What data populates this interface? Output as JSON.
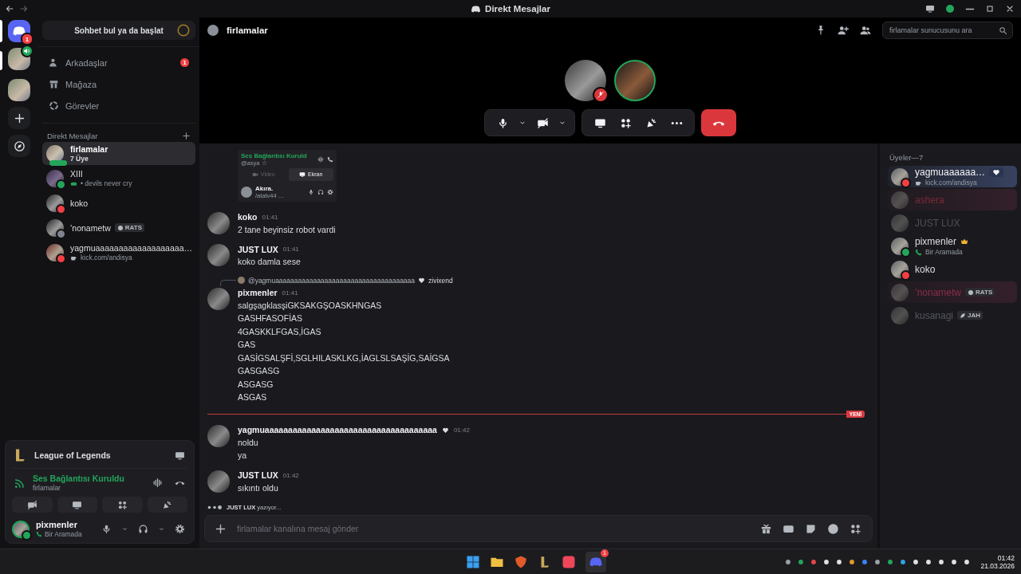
{
  "titlebar": {
    "title": "Direkt Mesajlar"
  },
  "servers": [
    {
      "kind": "home",
      "selected": true,
      "unread": false,
      "badge": "1",
      "speaking": false
    },
    {
      "kind": "server",
      "selected": false,
      "unread": true,
      "speaking": true
    },
    {
      "kind": "server",
      "selected": false,
      "unread": false,
      "speaking": false
    },
    {
      "kind": "add",
      "selected": false,
      "unread": false,
      "speaking": false
    },
    {
      "kind": "discover",
      "selected": false,
      "unread": false,
      "speaking": false
    }
  ],
  "dm_sidebar": {
    "search_button": "Sohbet bul ya da başlat",
    "nav": [
      {
        "kind": "friends",
        "label": "Arkadaşlar",
        "badge": "1"
      },
      {
        "kind": "shop",
        "label": "Mağaza"
      },
      {
        "kind": "quests",
        "label": "Görevler"
      }
    ],
    "section_title": "Direkt Mesajlar",
    "dms": [
      {
        "kind": "group",
        "name": "firlamalar",
        "subtitle": "7 Üye",
        "selected": true,
        "in_call": true
      },
      {
        "kind": "game",
        "name": "XIII",
        "subtitle": "• devils never cry",
        "selected": false,
        "in_call": false,
        "color": "#23a55a"
      },
      {
        "kind": "user",
        "name": "koko",
        "selected": false,
        "in_call": false,
        "color": "#f23f43"
      },
      {
        "kind": "user",
        "name": "ʼnonametw",
        "tag": "RATS",
        "selected": false,
        "in_call": false,
        "color": "#80848e"
      },
      {
        "kind": "custom",
        "name": "yagmuaaaaaaaaaaaaaaaaaaa…",
        "subtitle": "kick.com/andisya",
        "selected": false,
        "in_call": false,
        "color": "#f23f43"
      }
    ]
  },
  "user_panel": {
    "activity": {
      "title": "League of Legends"
    },
    "voice": {
      "status": "Ses Bağlantısı Kuruldu",
      "channel": "firlamalar"
    },
    "user": {
      "name": "pixmenler",
      "status": "Bir Aramada"
    }
  },
  "channel_header": {
    "name": "firlamalar",
    "search_placeholder": "firlamalar sunucusunu ara"
  },
  "call": {
    "participants": [
      {
        "muted": true,
        "speaking": false
      },
      {
        "muted": false,
        "speaking": true
      }
    ]
  },
  "chat": {
    "attachment": {
      "voice_status": "Ses Bağlantısı Kuruld",
      "user_line": "@asya ☆",
      "tabs": [
        {
          "label": "Video",
          "selected": false
        },
        {
          "label": "Ekran",
          "selected": true
        }
      ],
      "user_name": "Akıra.",
      "user_status": "/atatv44 …"
    },
    "messages": [
      {
        "kind": "message",
        "author": "koko",
        "time": "01:41",
        "lines": [
          "2 tane beyinsiz robot vardi"
        ]
      },
      {
        "kind": "message",
        "author": "JUST LUX",
        "time": "01:41",
        "lines": [
          "koko damla sese"
        ]
      },
      {
        "kind": "message",
        "author": "pixmenler",
        "time": "01:41",
        "reply": {
          "author": "@yagmuaaaaaaaaaaaaaaaaaaaaaaaaaaaaaaaaaaaaa",
          "text": "zivixend"
        },
        "lines": [
          "salgşagklasşiGKSAKGŞOASKHNGAS",
          "GASHFASOFİAS",
          "4GASKKLFGAS,İGAS",
          "GAS",
          "GASİGSALŞFİ,SGLHILASKLKG,İAGLSLSAŞİG,SAİGSA",
          "GASGASG",
          "ASGASG",
          "ASGAS"
        ]
      },
      {
        "kind": "divider",
        "label": "YENİ"
      },
      {
        "kind": "message",
        "author": "yagmuaaaaaaaaaaaaaaaaaaaaaaaaaaaaaaaaaaaaa",
        "time": "01:42",
        "lines": [
          "noldu",
          "ya"
        ]
      },
      {
        "kind": "message",
        "author": "JUST LUX",
        "time": "01:42",
        "lines": [
          "sıkıntı oldu"
        ]
      }
    ],
    "typing": "**JUST LUX** yazıyor...",
    "composer_placeholder": "firlamalar kanalına mesaj gönder"
  },
  "members": {
    "title": "Üyeler—7",
    "list": [
      {
        "kind": "dnd",
        "name": "yagmuaaaaaa…",
        "subtitle": "kick.com/andisya",
        "dimmed": false,
        "nameplate": true,
        "owner": false,
        "color": "#f2f3f5"
      },
      {
        "kind": "none",
        "name": "ashera",
        "dimmed": true,
        "nameplate": true,
        "owner": false,
        "color": "#7a2a38"
      },
      {
        "kind": "none",
        "name": "JUST LUX",
        "dimmed": true,
        "nameplate": false,
        "owner": false,
        "color": "#4e5058"
      },
      {
        "kind": "online",
        "name": "pixmenler",
        "subtitle": "Bir Aramada",
        "dimmed": false,
        "nameplate": false,
        "owner": true,
        "color": "#dbdee1"
      },
      {
        "kind": "dnd",
        "name": "koko",
        "dimmed": false,
        "nameplate": false,
        "owner": false,
        "color": "#dbdee1"
      },
      {
        "kind": "none",
        "name": "ʼnonametw",
        "tag": "RATS",
        "dimmed": true,
        "nameplate": true,
        "owner": false,
        "color": "#8a2d4a"
      },
      {
        "kind": "none",
        "name": "kusanagi",
        "tag": "JAH",
        "dimmed": true,
        "nameplate": false,
        "owner": false,
        "color": "#55575f"
      }
    ]
  },
  "taskbar": {
    "discord_badge": "1",
    "time": "01:42",
    "date": "21.03.2026"
  }
}
